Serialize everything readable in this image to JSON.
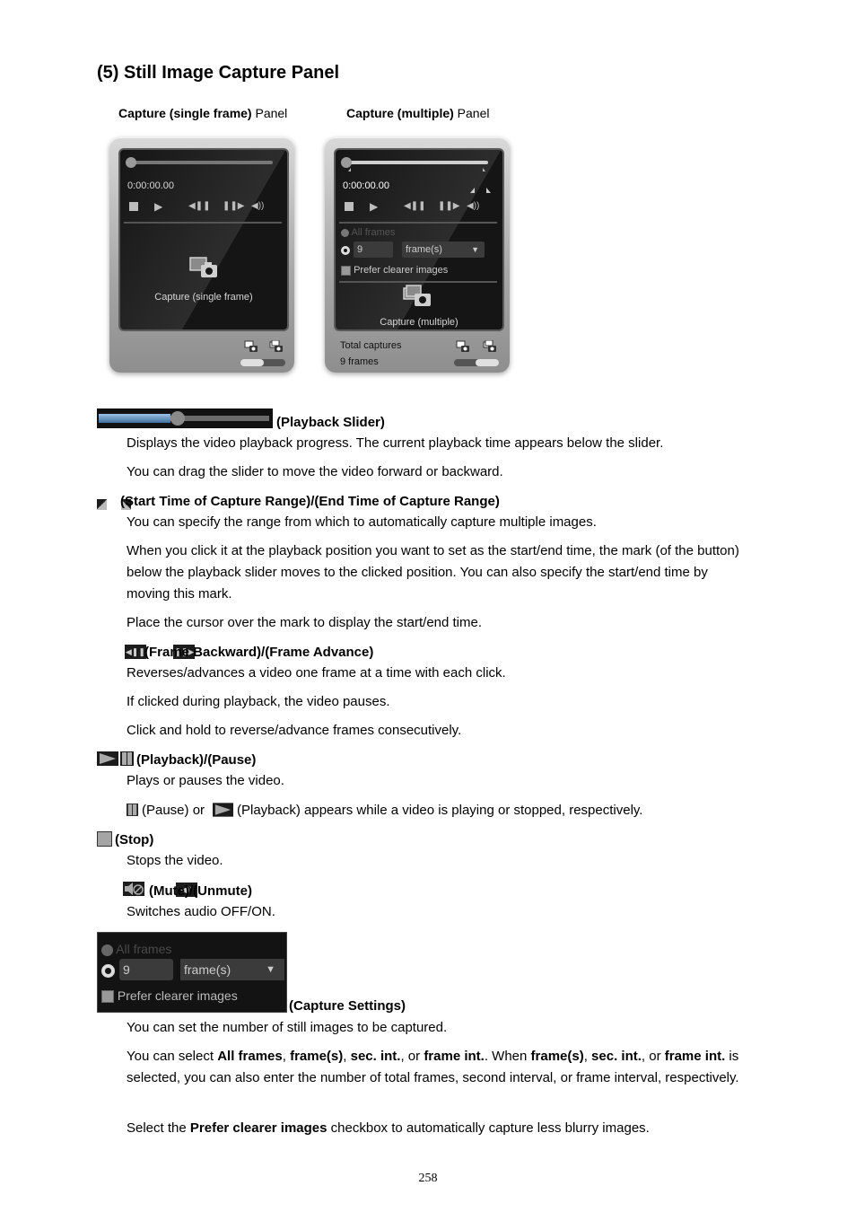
{
  "heading": "(5) Still Image Capture Panel",
  "panels": {
    "single": {
      "label_bold": "Capture (single frame)",
      "label_rest": " Panel",
      "timecode": "0:00:00.00",
      "capture_label": "Capture (single frame)"
    },
    "multiple": {
      "label_bold": "Capture (multiple)",
      "label_rest": " Panel",
      "timecode": "0:00:00.00",
      "all_frames": "All frames",
      "count_value": "9",
      "unit_selected": "frame(s)",
      "prefer_clearer": "Prefer clearer images",
      "capture_label": "Capture (multiple)",
      "total_label": "Total captures",
      "total_value": "9 frames"
    }
  },
  "icons": {
    "stop": "■",
    "play": "▶",
    "frame_back": "◀❚❚",
    "frame_adv": "❚❚▶",
    "volume": "◀))",
    "dropdown": "▼"
  },
  "sections": {
    "slider": {
      "term": "(Playback Slider)",
      "desc": [
        "Displays the video playback progress. The current playback time appears below the slider.",
        "You can drag the slider to move the video forward or backward."
      ]
    },
    "range": {
      "term": "(Start Time of Capture Range)/(End Time of Capture Range)",
      "desc": [
        "You can specify the range from which to automatically capture multiple images.",
        "When you click it at the playback position you want to set as the start/end time, the mark (of the button) below the playback slider moves to the clicked position. You can also specify the start/end time by moving this mark.",
        "Place the cursor over the mark to display the start/end time."
      ]
    },
    "frame": {
      "term": "(Frame Backward)/(Frame Advance)",
      "desc": [
        "Reverses/advances a video one frame at a time with each click.",
        "If clicked during playback, the video pauses.",
        "Click and hold to reverse/advance frames consecutively."
      ]
    },
    "play": {
      "term": "(Playback)/(Pause)",
      "desc": [
        "Plays or pauses the video."
      ],
      "note_pause": "(Pause) or",
      "note_play": "(Playback) appears while a video is playing or stopped, respectively."
    },
    "stop": {
      "term": "(Stop)",
      "desc": [
        "Stops the video."
      ]
    },
    "mute": {
      "term": "(Mute)/(Unmute)",
      "desc": [
        "Switches audio OFF/ON."
      ]
    },
    "settings": {
      "term": "(Capture Settings)",
      "desc0": "You can set the number of still images to be captured.",
      "desc1_parts": [
        "You can select ",
        "All frames",
        ", ",
        "frame(s)",
        ", ",
        "sec. int.",
        ", or ",
        "frame int.",
        ". When ",
        "frame(s)",
        ", ",
        "sec. int.",
        ", or ",
        "frame int.",
        " is selected, you can also enter the number of total frames, second interval, or frame interval, respectively."
      ],
      "desc2_parts": [
        "Select the ",
        "Prefer clearer images",
        " checkbox to automatically capture less blurry images."
      ]
    }
  },
  "page_number": "258"
}
